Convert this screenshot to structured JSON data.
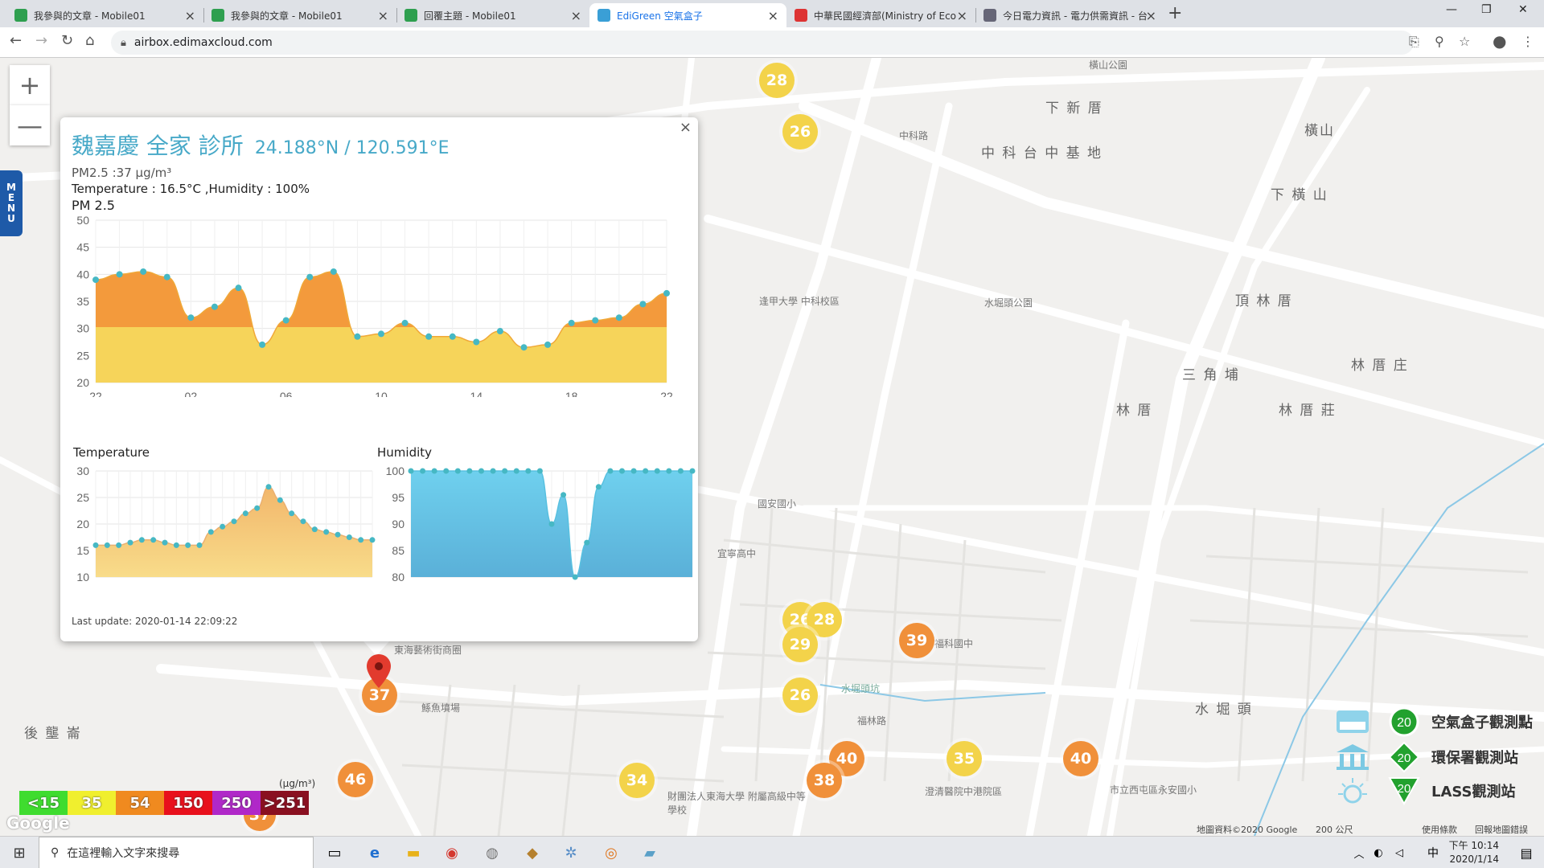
{
  "browser": {
    "tabs": [
      {
        "label": "我參與的文章 - Mobile01",
        "active": false,
        "icon_color": "#2e9f4f"
      },
      {
        "label": "我參與的文章 - Mobile01",
        "active": false,
        "icon_color": "#2e9f4f"
      },
      {
        "label": "回覆主題 - Mobile01",
        "active": false,
        "icon_color": "#2e9f4f"
      },
      {
        "label": "EdiGreen 空氣盒子",
        "active": true,
        "icon_color": "#3a9fd6"
      },
      {
        "label": "中華民國經濟部(Ministry of Eco",
        "active": false,
        "icon_color": "#d33"
      },
      {
        "label": "今日電力資訊 - 電力供需資訊 - 台",
        "active": false,
        "icon_color": "#667"
      }
    ],
    "url": "airbox.edimaxcloud.com",
    "new_tab": "+",
    "min": "—",
    "max": "❐",
    "close": "✕"
  },
  "map": {
    "zoom_in": "+",
    "zoom_out": "—",
    "menu_letters": [
      "M",
      "E",
      "N",
      "U"
    ],
    "labels": [
      {
        "text": "下 新 厝"
      },
      {
        "text": "中 科 台 中 基 地"
      },
      {
        "text": "下 橫 山"
      },
      {
        "text": "橫山"
      },
      {
        "text": "頂 林 厝"
      },
      {
        "text": "林 厝 庄"
      },
      {
        "text": "林 厝 莊"
      },
      {
        "text": "三 角 埔"
      },
      {
        "text": "林 厝"
      },
      {
        "text": "水 堀 頭"
      },
      {
        "text": "後 壟 崙"
      },
      {
        "text": "逢甲大學 中科校區"
      },
      {
        "text": "水堀頭公園"
      },
      {
        "text": "國安國小"
      },
      {
        "text": "宜寧高中"
      },
      {
        "text": "東海藝術街商圈"
      },
      {
        "text": "鯀魚墳場"
      },
      {
        "text": "財團法人東海大學 附屬高級中等學校"
      },
      {
        "text": "澄清醫院中港院區"
      },
      {
        "text": "市立西屯區永安國小"
      },
      {
        "text": "福科國中"
      },
      {
        "text": "水堀頭坑"
      },
      {
        "text": "橫山公園"
      },
      {
        "text": "中科路"
      },
      {
        "text": "福林路"
      }
    ],
    "markers": [
      {
        "value": "28",
        "color": "y"
      },
      {
        "value": "26",
        "color": "y"
      },
      {
        "value": "26",
        "color": "y"
      },
      {
        "value": "28",
        "color": "y"
      },
      {
        "value": "29",
        "color": "y"
      },
      {
        "value": "39",
        "color": "o"
      },
      {
        "value": "26",
        "color": "y"
      },
      {
        "value": "40",
        "color": "o"
      },
      {
        "value": "35",
        "color": "y"
      },
      {
        "value": "40",
        "color": "o"
      },
      {
        "value": "34",
        "color": "y"
      },
      {
        "value": "38",
        "color": "o"
      },
      {
        "value": "46",
        "color": "o"
      },
      {
        "value": "37",
        "color": "o"
      },
      {
        "value": "37",
        "color": "o"
      }
    ],
    "scale_unit": "(μg/m³)",
    "scale": [
      {
        "label": "<15",
        "color": "#3fdc2f"
      },
      {
        "label": "35",
        "color": "#f0ef2e"
      },
      {
        "label": "54",
        "color": "#f08a1f"
      },
      {
        "label": "150",
        "color": "#e8101c"
      },
      {
        "label": "250",
        "color": "#b028c8"
      },
      {
        "label": ">251",
        "color": "#8a1020"
      }
    ],
    "station_legend": [
      {
        "label": "空氣盒子觀測點",
        "value": "20"
      },
      {
        "label": "環保署觀測站",
        "value": "20"
      },
      {
        "label": "LASS觀測站",
        "value": "20"
      }
    ],
    "attribution": "地圖資料©2020 Google",
    "scale_bar": "200 公尺",
    "terms": "使用條款",
    "report": "回報地圖錯誤",
    "google": "Google"
  },
  "popup": {
    "name": "魏嘉慶 全家 診所",
    "coord": "24.188°N / 120.591°E",
    "pm_line": "PM2.5 :37 μg/m³",
    "env_line": "Temperature : 16.5°C ,Humidity : 100%",
    "pm_title": "PM 2.5",
    "temp_title": "Temperature",
    "hum_title": "Humidity",
    "last_update": "Last update: 2020-01-14 22:09:22",
    "close": "×"
  },
  "chart_data": [
    {
      "type": "area",
      "title": "PM 2.5",
      "x_ticks": [
        "22",
        "02",
        "06",
        "10",
        "14",
        "18",
        "22"
      ],
      "ylim": [
        20,
        50
      ],
      "y_ticks": [
        20,
        25,
        30,
        35,
        40,
        45,
        50
      ],
      "values": [
        39,
        40,
        40.5,
        39.5,
        32,
        34,
        37.5,
        27,
        31.5,
        39.5,
        40.5,
        28.5,
        29,
        31,
        28.5,
        28.5,
        27.5,
        29.5,
        26.5,
        27,
        31,
        31.5,
        32,
        34.5,
        36.5
      ],
      "threshold": 35,
      "colors": {
        "low": "#f6d45a",
        "high": "#f39a3c",
        "point": "#46b8c4"
      }
    },
    {
      "type": "area",
      "title": "Temperature",
      "ylim": [
        10,
        30
      ],
      "y_ticks": [
        10,
        15,
        20,
        25,
        30
      ],
      "values": [
        16,
        16,
        16,
        16.5,
        17,
        17,
        16.5,
        16,
        16,
        16,
        18.5,
        19.5,
        20.5,
        22,
        23,
        27,
        24.5,
        22,
        20.5,
        19,
        18.5,
        18,
        17.5,
        17,
        17
      ]
    },
    {
      "type": "area",
      "title": "Humidity",
      "ylim": [
        80,
        100
      ],
      "y_ticks": [
        80,
        85,
        90,
        95,
        100
      ],
      "values": [
        100,
        100,
        100,
        100,
        100,
        100,
        100,
        100,
        100,
        100,
        100,
        100,
        90,
        95.5,
        80,
        86.5,
        97,
        100,
        100,
        100,
        100,
        100,
        100,
        100,
        100
      ]
    }
  ],
  "taskbar": {
    "search_placeholder": "在這裡輸入文字來搜尋",
    "time": "下午 10:14",
    "date": "2020/1/14",
    "ime": "中"
  }
}
